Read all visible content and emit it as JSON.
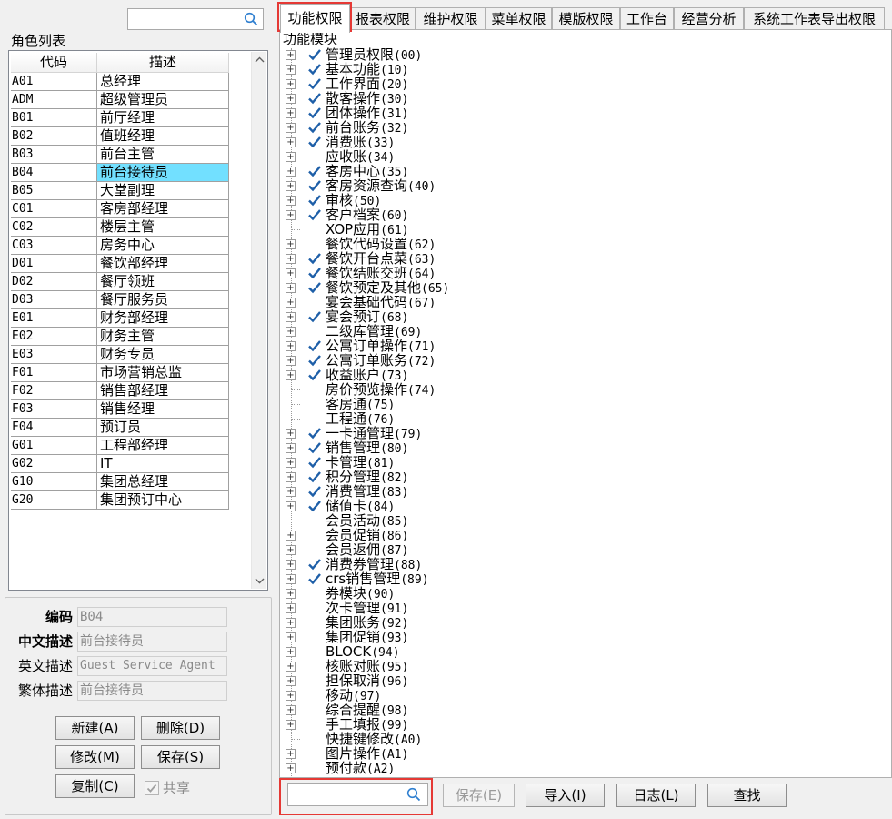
{
  "left": {
    "search": {
      "value": "",
      "placeholder": ""
    },
    "role_list_title": "角色列表",
    "columns": [
      "代码",
      "描述"
    ],
    "roles": [
      {
        "code": "A01",
        "desc": "总经理"
      },
      {
        "code": "ADM",
        "desc": "超级管理员"
      },
      {
        "code": "B01",
        "desc": "前厅经理"
      },
      {
        "code": "B02",
        "desc": "值班经理"
      },
      {
        "code": "B03",
        "desc": "前台主管"
      },
      {
        "code": "B04",
        "desc": "前台接待员",
        "selected": true
      },
      {
        "code": "B05",
        "desc": "大堂副理"
      },
      {
        "code": "C01",
        "desc": "客房部经理"
      },
      {
        "code": "C02",
        "desc": "楼层主管"
      },
      {
        "code": "C03",
        "desc": "房务中心"
      },
      {
        "code": "D01",
        "desc": "餐饮部经理"
      },
      {
        "code": "D02",
        "desc": "餐厅领班"
      },
      {
        "code": "D03",
        "desc": "餐厅服务员"
      },
      {
        "code": "E01",
        "desc": "财务部经理"
      },
      {
        "code": "E02",
        "desc": "财务主管"
      },
      {
        "code": "E03",
        "desc": "财务专员"
      },
      {
        "code": "F01",
        "desc": "市场营销总监"
      },
      {
        "code": "F02",
        "desc": "销售部经理"
      },
      {
        "code": "F03",
        "desc": "销售经理"
      },
      {
        "code": "F04",
        "desc": "预订员"
      },
      {
        "code": "G01",
        "desc": "工程部经理"
      },
      {
        "code": "G02",
        "desc": "IT"
      },
      {
        "code": "G10",
        "desc": "集团总经理"
      },
      {
        "code": "G20",
        "desc": "集团预订中心"
      }
    ],
    "detail": {
      "code_label": "编码",
      "code_value": "B04",
      "cn_label": "中文描述",
      "cn_value": "前台接待员",
      "en_label": "英文描述",
      "en_value": "Guest Service Agent",
      "tw_label": "繁体描述",
      "tw_value": "前台接待员"
    },
    "buttons": {
      "new": "新建(A)",
      "delete": "删除(D)",
      "modify": "修改(M)",
      "save": "保存(S)",
      "copy": "复制(C)",
      "share": "共享"
    }
  },
  "right": {
    "tabs": [
      "功能权限",
      "报表权限",
      "维护权限",
      "菜单权限",
      "模版权限",
      "工作台",
      "经营分析",
      "系统工作表导出权限"
    ],
    "active_tab": 0,
    "tree_title": "功能模块",
    "modules": [
      {
        "name": "管理员权限",
        "code": "(00)",
        "checked": true,
        "expander": true
      },
      {
        "name": "基本功能",
        "code": "(10)",
        "checked": true,
        "expander": true
      },
      {
        "name": "工作界面",
        "code": "(20)",
        "checked": true,
        "expander": true
      },
      {
        "name": "散客操作",
        "code": "(30)",
        "checked": true,
        "expander": true
      },
      {
        "name": "团体操作",
        "code": "(31)",
        "checked": true,
        "expander": true
      },
      {
        "name": "前台账务",
        "code": "(32)",
        "checked": true,
        "expander": true
      },
      {
        "name": "消费账",
        "code": "(33)",
        "checked": true,
        "expander": true
      },
      {
        "name": "应收账",
        "code": "(34)",
        "checked": false,
        "expander": true
      },
      {
        "name": "客房中心",
        "code": "(35)",
        "checked": true,
        "expander": true
      },
      {
        "name": "客房资源查询",
        "code": "(40)",
        "checked": true,
        "expander": true
      },
      {
        "name": "审核",
        "code": "(50)",
        "checked": true,
        "expander": true
      },
      {
        "name": "客户档案",
        "code": "(60)",
        "checked": true,
        "expander": true
      },
      {
        "name": "XOP应用",
        "code": "(61)",
        "checked": false,
        "expander": false
      },
      {
        "name": "餐饮代码设置",
        "code": "(62)",
        "checked": false,
        "expander": true
      },
      {
        "name": "餐饮开台点菜",
        "code": "(63)",
        "checked": true,
        "expander": true
      },
      {
        "name": "餐饮结账交班",
        "code": "(64)",
        "checked": true,
        "expander": true
      },
      {
        "name": "餐饮预定及其他",
        "code": "(65)",
        "checked": true,
        "expander": true
      },
      {
        "name": "宴会基础代码",
        "code": "(67)",
        "checked": false,
        "expander": true
      },
      {
        "name": "宴会预订",
        "code": "(68)",
        "checked": true,
        "expander": true
      },
      {
        "name": "二级库管理",
        "code": "(69)",
        "checked": false,
        "expander": true
      },
      {
        "name": "公寓订单操作",
        "code": "(71)",
        "checked": true,
        "expander": true
      },
      {
        "name": "公寓订单账务",
        "code": "(72)",
        "checked": true,
        "expander": true
      },
      {
        "name": "收益账户",
        "code": "(73)",
        "checked": true,
        "expander": true
      },
      {
        "name": "房价预览操作",
        "code": "(74)",
        "checked": false,
        "expander": false
      },
      {
        "name": "客房通",
        "code": "(75)",
        "checked": false,
        "expander": false
      },
      {
        "name": "工程通",
        "code": "(76)",
        "checked": false,
        "expander": false
      },
      {
        "name": "一卡通管理",
        "code": "(79)",
        "checked": true,
        "expander": true
      },
      {
        "name": "销售管理",
        "code": "(80)",
        "checked": true,
        "expander": true
      },
      {
        "name": "卡管理",
        "code": "(81)",
        "checked": true,
        "expander": true
      },
      {
        "name": "积分管理",
        "code": "(82)",
        "checked": true,
        "expander": true
      },
      {
        "name": "消费管理",
        "code": "(83)",
        "checked": true,
        "expander": true
      },
      {
        "name": "储值卡",
        "code": "(84)",
        "checked": true,
        "expander": true
      },
      {
        "name": "会员活动",
        "code": "(85)",
        "checked": false,
        "expander": false
      },
      {
        "name": "会员促销",
        "code": "(86)",
        "checked": false,
        "expander": true
      },
      {
        "name": "会员返佣",
        "code": "(87)",
        "checked": false,
        "expander": true
      },
      {
        "name": "消费券管理",
        "code": "(88)",
        "checked": true,
        "expander": true
      },
      {
        "name": "crs销售管理",
        "code": "(89)",
        "checked": true,
        "expander": true
      },
      {
        "name": "券模块",
        "code": "(90)",
        "checked": false,
        "expander": true
      },
      {
        "name": "次卡管理",
        "code": "(91)",
        "checked": false,
        "expander": true
      },
      {
        "name": "集团账务",
        "code": "(92)",
        "checked": false,
        "expander": true
      },
      {
        "name": "集团促销",
        "code": "(93)",
        "checked": false,
        "expander": true
      },
      {
        "name": "BLOCK",
        "code": "(94)",
        "checked": false,
        "expander": true
      },
      {
        "name": "核账对账",
        "code": "(95)",
        "checked": false,
        "expander": true
      },
      {
        "name": "担保取消",
        "code": "(96)",
        "checked": false,
        "expander": true
      },
      {
        "name": "移动",
        "code": "(97)",
        "checked": false,
        "expander": true
      },
      {
        "name": "综合提醒",
        "code": "(98)",
        "checked": false,
        "expander": true
      },
      {
        "name": "手工填报",
        "code": "(99)",
        "checked": false,
        "expander": true
      },
      {
        "name": "快捷键修改",
        "code": "(A0)",
        "checked": false,
        "expander": false
      },
      {
        "name": "图片操作",
        "code": "(A1)",
        "checked": false,
        "expander": true
      },
      {
        "name": "预付款",
        "code": "(A2)",
        "checked": false,
        "expander": true
      }
    ],
    "search": {
      "value": "",
      "placeholder": ""
    },
    "buttons": {
      "save": "保存(E)",
      "import": "导入(I)",
      "log": "日志(L)",
      "find": "查找"
    }
  },
  "colors": {
    "selected_row": "#72e0ff",
    "check": "#1e5fa8",
    "highlight_box": "#e53935"
  }
}
